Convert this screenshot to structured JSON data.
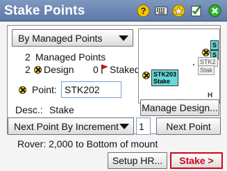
{
  "window": {
    "title": "Stake Points"
  },
  "titlebar_icons": [
    "help-icon",
    "keyboard-icon",
    "favorites-star-icon",
    "accept-check-icon",
    "close-icon"
  ],
  "mode_dropdown": {
    "value": "By Managed Points"
  },
  "managed": {
    "count": "2",
    "label": "Managed Points"
  },
  "design": {
    "count": "2",
    "label": "Design"
  },
  "staked": {
    "count": "0",
    "label": "Staked"
  },
  "map": {
    "labels": [
      {
        "text": "STK203\nStake"
      },
      {
        "text": "STK2"
      },
      {
        "text": "Stak"
      },
      {
        "text": "S"
      },
      {
        "text": "S"
      }
    ],
    "north_label": "H"
  },
  "point": {
    "label": "Point:",
    "value": "STK202"
  },
  "desc": {
    "label": "Desc.:",
    "value": "Stake"
  },
  "buttons": {
    "manage_design": "Manage Design...",
    "next_point": "Next Point",
    "setup_hr": "Setup HR...",
    "stake": "Stake >"
  },
  "next_mode_dropdown": {
    "value": "Next Point By Increment"
  },
  "increment": {
    "value": "1"
  },
  "rover": {
    "text": "Rover: 2,000 to Bottom of mount"
  },
  "colors": {
    "titlebar": "#6a86b3",
    "stake_accent": "#d4001a",
    "design_marker": "#ffd700",
    "label_fill": "#67d9d9",
    "staked_flag": "#e01010"
  }
}
